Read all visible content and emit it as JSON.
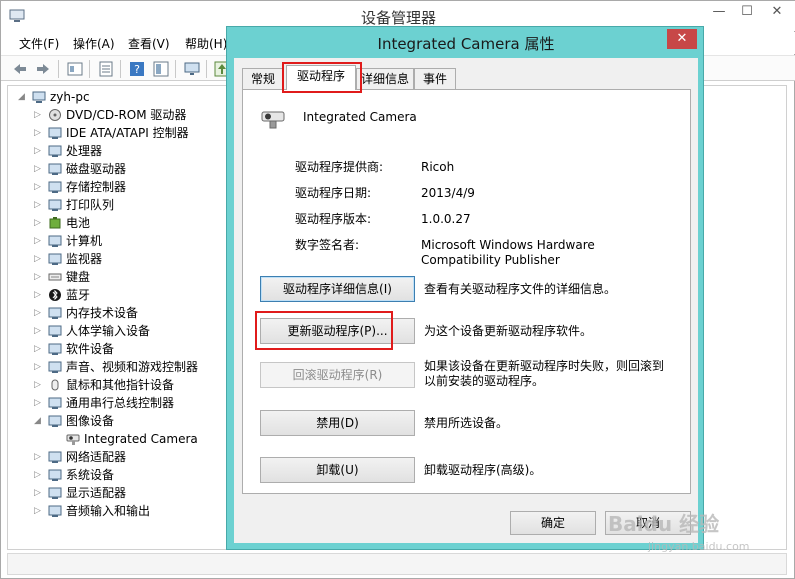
{
  "main_window": {
    "title": "设备管理器",
    "caption": {
      "minimize": "—",
      "maximize": "☐",
      "close": "✕"
    }
  },
  "menu": [
    "文件(F)",
    "操作(A)",
    "查看(V)",
    "帮助(H)"
  ],
  "toolbar_icons": [
    "back-icon",
    "forward-icon",
    "properties-icon",
    "sheet-icon",
    "help-icon",
    "view-icon",
    "monitor-icon",
    "update-driver-icon"
  ],
  "tree": {
    "root": "zyh-pc",
    "items": [
      {
        "label": "DVD/CD-ROM 驱动器",
        "icon": "dvd-drive-icon"
      },
      {
        "label": "IDE ATA/ATAPI 控制器",
        "icon": "ide-controller-icon"
      },
      {
        "label": "处理器",
        "icon": "processor-icon"
      },
      {
        "label": "磁盘驱动器",
        "icon": "disk-drive-icon"
      },
      {
        "label": "存储控制器",
        "icon": "storage-controller-icon"
      },
      {
        "label": "打印队列",
        "icon": "printer-icon"
      },
      {
        "label": "电池",
        "icon": "battery-icon"
      },
      {
        "label": "计算机",
        "icon": "computer-icon"
      },
      {
        "label": "监视器",
        "icon": "monitor-icon"
      },
      {
        "label": "键盘",
        "icon": "keyboard-icon"
      },
      {
        "label": "蓝牙",
        "icon": "bluetooth-icon"
      },
      {
        "label": "内存技术设备",
        "icon": "memory-device-icon"
      },
      {
        "label": "人体学输入设备",
        "icon": "hid-icon"
      },
      {
        "label": "软件设备",
        "icon": "software-device-icon"
      },
      {
        "label": "声音、视频和游戏控制器",
        "icon": "sound-icon"
      },
      {
        "label": "鼠标和其他指针设备",
        "icon": "mouse-icon"
      },
      {
        "label": "通用串行总线控制器",
        "icon": "usb-icon"
      },
      {
        "label": "图像设备",
        "icon": "imaging-device-icon",
        "expanded": true
      },
      {
        "label": "Integrated Camera",
        "icon": "camera-icon",
        "child": true
      },
      {
        "label": "网络适配器",
        "icon": "network-adapter-icon"
      },
      {
        "label": "系统设备",
        "icon": "system-device-icon"
      },
      {
        "label": "显示适配器",
        "icon": "display-adapter-icon"
      },
      {
        "label": "音频输入和输出",
        "icon": "audio-io-icon"
      }
    ]
  },
  "dialog": {
    "title": "Integrated Camera 属性",
    "close": "✕",
    "tabs": [
      "常规",
      "驱动程序",
      "详细信息",
      "事件"
    ],
    "active_tab": "驱动程序",
    "device_name": "Integrated Camera",
    "info": [
      {
        "label": "驱动程序提供商:",
        "value": "Ricoh"
      },
      {
        "label": "驱动程序日期:",
        "value": "2013/4/9"
      },
      {
        "label": "驱动程序版本:",
        "value": "1.0.0.27"
      },
      {
        "label": "数字签名者:",
        "value": "Microsoft Windows Hardware Compatibility Publisher"
      }
    ],
    "actions": [
      {
        "button": "驱动程序详细信息(I)",
        "desc": "查看有关驱动程序文件的详细信息。",
        "enabled": true
      },
      {
        "button": "更新驱动程序(P)...",
        "desc": "为这个设备更新驱动程序软件。",
        "enabled": true
      },
      {
        "button": "回滚驱动程序(R)",
        "desc": "如果该设备在更新驱动程序时失败，则回滚到以前安装的驱动程序。",
        "enabled": false
      },
      {
        "button": "禁用(D)",
        "desc": "禁用所选设备。",
        "enabled": true
      },
      {
        "button": "卸载(U)",
        "desc": "卸载驱动程序(高级)。",
        "enabled": true
      }
    ],
    "ok": "确定",
    "cancel": "取消"
  },
  "watermark": {
    "brand": "Baidu 经验",
    "url": "jingyan.baidu.com"
  },
  "colors": {
    "dialog_frame": "#6cd1d1",
    "close_button": "#c74747",
    "highlight_box": "#e01b1b"
  }
}
